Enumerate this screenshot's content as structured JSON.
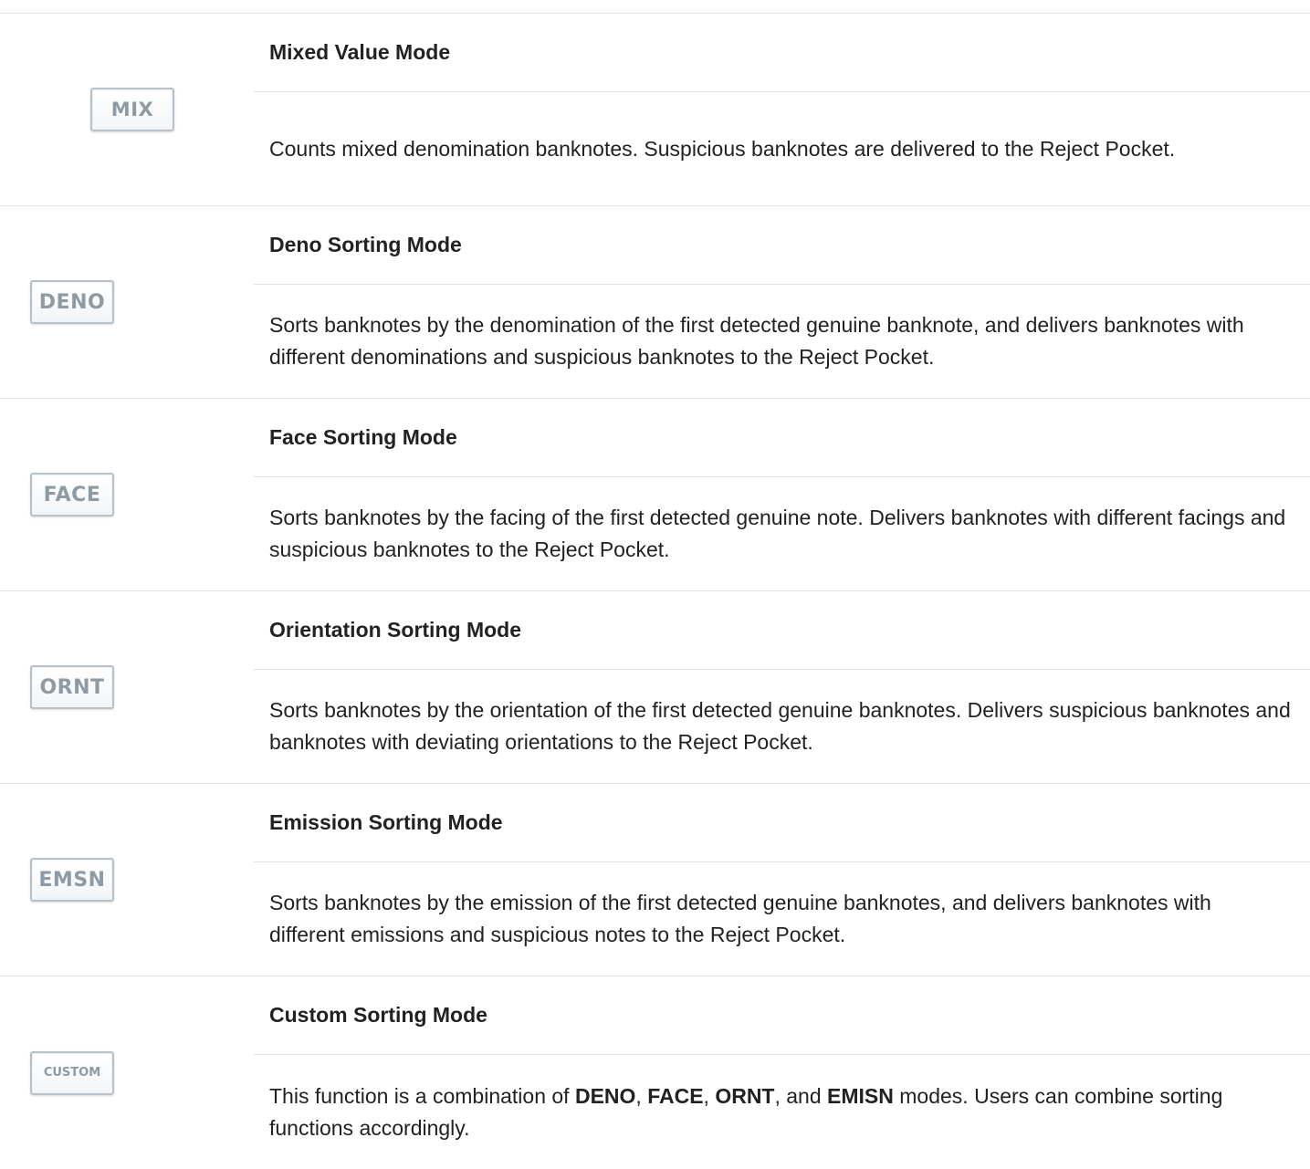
{
  "modes": [
    {
      "icon_label": "MIX",
      "title": "Mixed Value Mode",
      "description": "Counts mixed denomination banknotes. Suspicious banknotes are delivered to the Reject Pocket."
    },
    {
      "icon_label": "DENO",
      "title": "Deno Sorting Mode",
      "description": "Sorts banknotes by the denomination of the first detected genuine banknote, and delivers banknotes with different denominations and suspicious banknotes to the Reject Pocket."
    },
    {
      "icon_label": "FACE",
      "title": "Face Sorting Mode",
      "description": "Sorts banknotes by the facing of the first detected genuine note. Delivers banknotes with different facings and suspicious banknotes to the Reject Pocket."
    },
    {
      "icon_label": "ORNT",
      "title": "Orientation Sorting Mode",
      "description": "Sorts banknotes by the orientation of the first detected genuine banknotes. Delivers suspicious banknotes and banknotes with deviating orientations to the Reject Pocket."
    },
    {
      "icon_label": "EMSN",
      "title": "Emission Sorting Mode",
      "description": "Sorts banknotes by the emission of the first detected genuine banknotes, and delivers banknotes with different emissions and suspicious notes to the Reject Pocket."
    },
    {
      "icon_label": "CUSTOM",
      "title": "Custom Sorting Mode",
      "description_parts": {
        "p1": "This function is a combination of ",
        "b1": "DENO",
        "p2": ", ",
        "b2": "FACE",
        "p3": ", ",
        "b3": "ORNT",
        "p4": ", and ",
        "b4": "EMISN",
        "p5": " modes. Users can combine sorting functions accordingly."
      }
    }
  ]
}
